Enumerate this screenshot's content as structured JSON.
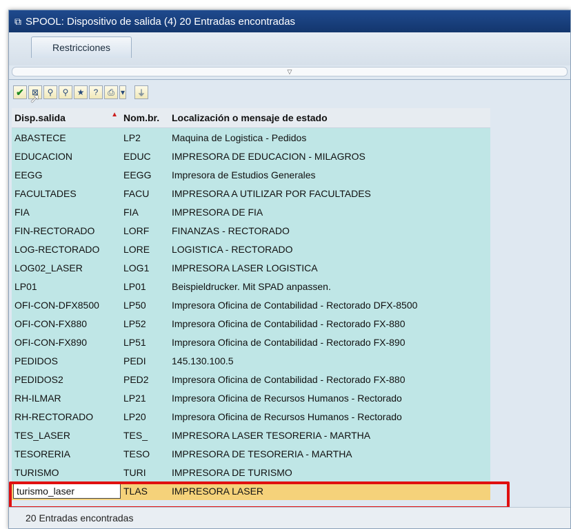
{
  "window": {
    "title": "SPOOL: Dispositivo de salida (4)   20 Entradas encontradas"
  },
  "tabs": [
    {
      "label": "Restricciones"
    }
  ],
  "toolbar": {
    "buttons": [
      {
        "name": "confirm-button",
        "icon": "check-icon"
      },
      {
        "name": "cancel-button",
        "icon": "close-icon"
      },
      {
        "name": "find-button",
        "icon": "binoculars-icon"
      },
      {
        "name": "find-next-button",
        "icon": "binoculars-next-icon"
      },
      {
        "name": "favorites-button",
        "icon": "star-icon"
      },
      {
        "name": "help-button",
        "icon": "help-icon"
      },
      {
        "name": "print-button",
        "icon": "printer-icon"
      },
      {
        "name": "print-menu-button",
        "icon": "dropdown-icon"
      },
      {
        "name": "filter-button",
        "icon": "filter-icon"
      }
    ]
  },
  "table": {
    "columns": [
      "Disp.salida",
      "Nom.br.",
      "Localización o mensaje de estado"
    ],
    "rows": [
      [
        "ABASTECE",
        "LP2",
        "Maquina de Logistica - Pedidos"
      ],
      [
        "EDUCACION",
        "EDUC",
        "IMPRESORA  DE  EDUCACION - MILAGROS"
      ],
      [
        "EEGG",
        "EEGG",
        "Impresora de Estudios Generales"
      ],
      [
        "FACULTADES",
        "FACU",
        "IMPRESORA A UTILIZAR POR FACULTADES"
      ],
      [
        "FIA",
        "FIA",
        "IMPRESORA  DE  FIA"
      ],
      [
        "FIN-RECTORADO",
        "LORF",
        "FINANZAS - RECTORADO"
      ],
      [
        "LOG-RECTORADO",
        "LORE",
        "LOGISTICA - RECTORADO"
      ],
      [
        "LOG02_LASER",
        "LOG1",
        "IMPRESORA LASER LOGISTICA"
      ],
      [
        "LP01",
        "LP01",
        "Beispieldrucker. Mit SPAD anpassen."
      ],
      [
        "OFI-CON-DFX8500",
        "LP50",
        "Impresora Oficina de Contabilidad - Rectorado  DFX-8500"
      ],
      [
        "OFI-CON-FX880",
        "LP52",
        "Impresora Oficina de Contabilidad - Rectorado  FX-880"
      ],
      [
        "OFI-CON-FX890",
        "LP51",
        "Impresora Oficina de Contabilidad - Rectorado  FX-890"
      ],
      [
        "PEDIDOS",
        "PEDI",
        "145.130.100.5"
      ],
      [
        "PEDIDOS2",
        "PED2",
        "Impresora Oficina de Contabilidad - Rectorado FX-880"
      ],
      [
        "RH-ILMAR",
        "LP21",
        "Impresora Oficina de Recursos Humanos - Rectorado"
      ],
      [
        "RH-RECTORADO",
        "LP20",
        "Impresora Oficina de Recursos Humanos - Rectorado"
      ],
      [
        "TES_LASER",
        "TES_",
        "IMPRESORA LASER  TESORERIA - MARTHA"
      ],
      [
        "TESORERIA",
        "TESO",
        "IMPRESORA DE TESORERIA - MARTHA"
      ],
      [
        "TURISMO",
        "TURI",
        "IMPRESORA  DE  TURISMO"
      ]
    ],
    "selected_row": [
      "turismo_laser",
      "TLAS",
      "IMPRESORA LASER"
    ]
  },
  "status": {
    "text": "20 Entradas encontradas"
  },
  "colors": {
    "row_bg": "#bfe6e6",
    "selected_bg": "#f5d27a",
    "highlight_border": "#e01010",
    "titlebar": "#1f4a8e"
  }
}
